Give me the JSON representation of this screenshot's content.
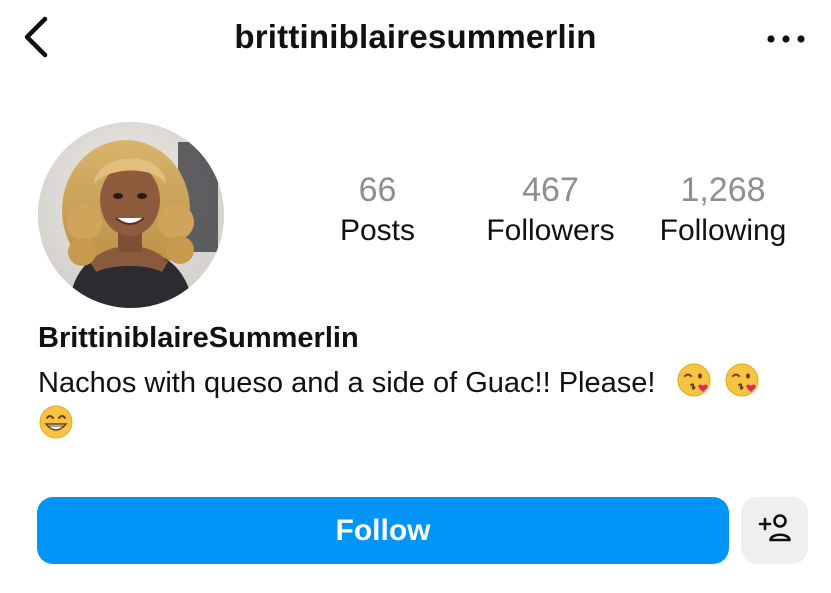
{
  "header": {
    "username": "brittiniblairesummerlin",
    "back_icon": "chevron-left-icon",
    "more_icon": "more-horizontal-icon"
  },
  "profile": {
    "avatar_alt": "profile picture",
    "stats": [
      {
        "value": "66",
        "label": "Posts"
      },
      {
        "value": "467",
        "label": "Followers"
      },
      {
        "value": "1,268",
        "label": "Following"
      }
    ],
    "display_name": "BrittiniblaireSummerlin",
    "bio_text": "Nachos with queso and a side of Guac!! Please!",
    "bio_emojis": [
      "face-blowing-kiss-emoji",
      "face-blowing-kiss-emoji",
      "grinning-face-emoji"
    ]
  },
  "actions": {
    "follow_label": "Follow",
    "add_user_icon": "add-person-icon"
  },
  "colors": {
    "follow_bg": "#0095f6",
    "secondary_btn_bg": "#efefef",
    "stat_number": "#8e8e8e"
  }
}
